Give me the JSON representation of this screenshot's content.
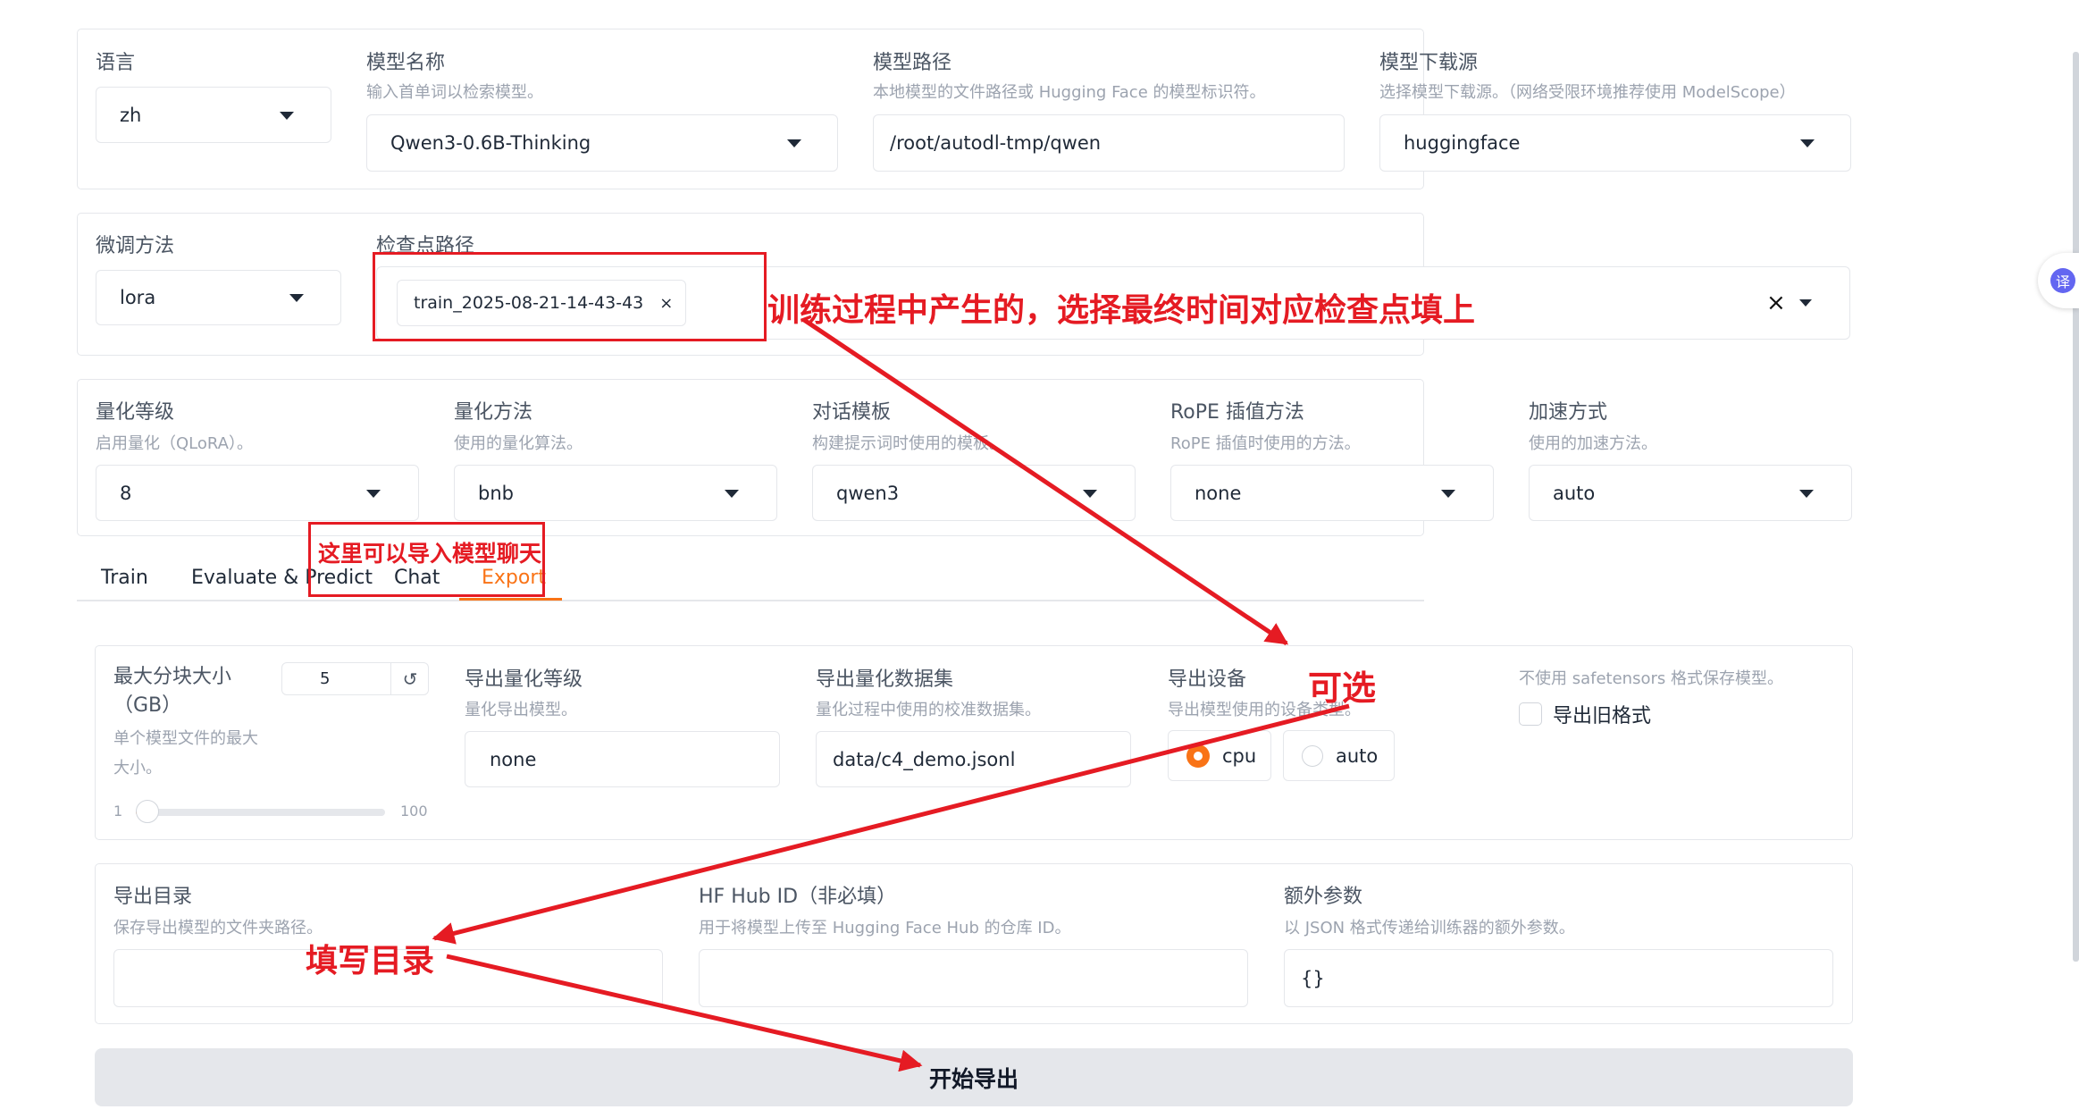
{
  "top": {
    "lang": {
      "label": "语言",
      "value": "zh"
    },
    "model_name": {
      "label": "模型名称",
      "info": "输入首单词以检索模型。",
      "value": "Qwen3-0.6B-Thinking"
    },
    "model_path": {
      "label": "模型路径",
      "info": "本地模型的文件路径或 Hugging Face 的模型标识符。",
      "value": "/root/autodl-tmp/qwen"
    },
    "hub": {
      "label": "模型下载源",
      "info": "选择模型下载源。（网络受限环境推荐使用 ModelScope）",
      "value": "huggingface"
    }
  },
  "finetune": {
    "method": {
      "label": "微调方法",
      "value": "lora"
    },
    "checkpoint": {
      "label": "检查点路径",
      "chip": "train_2025-08-21-14-43-43",
      "chip_close": "×",
      "clear": "×"
    }
  },
  "advanced": {
    "quant_bit": {
      "label": "量化等级",
      "info": "启用量化（QLoRA）。",
      "value": "8"
    },
    "quant_method": {
      "label": "量化方法",
      "info": "使用的量化算法。",
      "value": "bnb"
    },
    "template": {
      "label": "对话模板",
      "info": "构建提示词时使用的模板。",
      "value": "qwen3"
    },
    "rope": {
      "label": "RoPE 插值方法",
      "info": "RoPE 插值时使用的方法。",
      "value": "none"
    },
    "booster": {
      "label": "加速方式",
      "info": "使用的加速方法。",
      "value": "auto"
    }
  },
  "tabs": [
    {
      "label": "Train"
    },
    {
      "label": "Evaluate & Predict"
    },
    {
      "label": "Chat"
    },
    {
      "label": "Export"
    }
  ],
  "active_tab": "Export",
  "export": {
    "size": {
      "label_line1": "最大分块大小",
      "label_line2": "（GB）",
      "info_line1": "单个模型文件的最大",
      "info_line2": "大小。",
      "value": "5",
      "reset": "↺",
      "min": "1",
      "max": "100",
      "level": 0.04
    },
    "quant": {
      "label": "导出量化等级",
      "info": "量化导出模型。",
      "value": "none"
    },
    "dataset": {
      "label": "导出量化数据集",
      "info": "量化过程中使用的校准数据集。",
      "value": "data/c4_demo.jsonl"
    },
    "device": {
      "label": "导出设备",
      "info": "导出模型使用的设备类型。",
      "options": [
        "cpu",
        "auto"
      ],
      "selected": "cpu"
    },
    "legacy": {
      "info": "不使用 safetensors 格式保存模型。",
      "label": "导出旧格式",
      "checked": false
    },
    "dir": {
      "label": "导出目录",
      "info": "保存导出模型的文件夹路径。",
      "value": ""
    },
    "hub_id": {
      "label": "HF Hub ID（非必填）",
      "info": "用于将模型上传至 Hugging Face Hub 的仓库 ID。",
      "value": ""
    },
    "extra": {
      "label": "额外参数",
      "info": "以 JSON 格式传递给训练器的额外参数。",
      "value": "{}"
    },
    "button": "开始导出"
  },
  "annotations": {
    "checkpoint_note": "训练过程中产生的，选择最终时间对应检查点填上",
    "chat_note": "这里可以导入模型聊天",
    "optional_note": "可选",
    "dir_note": "填写目录"
  },
  "translate_badge": "译",
  "colors": {
    "accent": "#f97316",
    "annotation": "#e51b23",
    "button_bg": "#e5e7eb"
  }
}
